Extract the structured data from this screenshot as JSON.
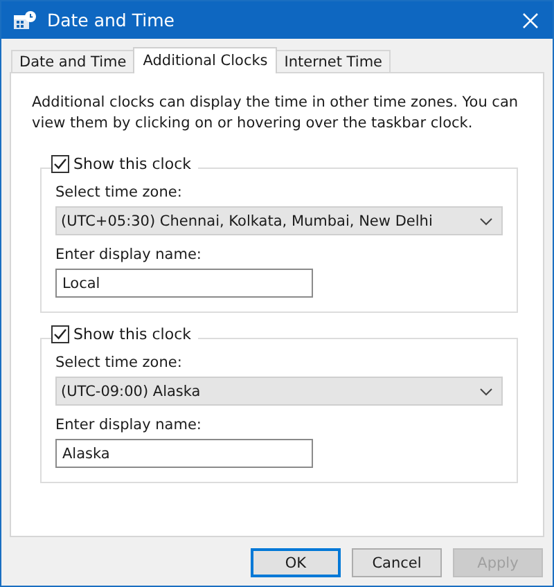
{
  "window": {
    "title": "Date and Time"
  },
  "tabs": [
    {
      "label": "Date and Time",
      "selected": false
    },
    {
      "label": "Additional Clocks",
      "selected": true
    },
    {
      "label": "Internet Time",
      "selected": false
    }
  ],
  "description": "Additional clocks can display the time in other time zones. You can view them by clicking on or hovering over the taskbar clock.",
  "clocks": [
    {
      "show_label": "Show this clock",
      "checked": true,
      "timezone_label": "Select time zone:",
      "timezone": "(UTC+05:30) Chennai, Kolkata, Mumbai, New Delhi",
      "name_label": "Enter display name:",
      "display_name": "Local"
    },
    {
      "show_label": "Show this clock",
      "checked": true,
      "timezone_label": "Select time zone:",
      "timezone": "(UTC-09:00) Alaska",
      "name_label": "Enter display name:",
      "display_name": "Alaska"
    }
  ],
  "buttons": [
    {
      "label": "OK",
      "default": true,
      "disabled": false
    },
    {
      "label": "Cancel",
      "default": false,
      "disabled": false
    },
    {
      "label": "Apply",
      "default": false,
      "disabled": true
    }
  ]
}
